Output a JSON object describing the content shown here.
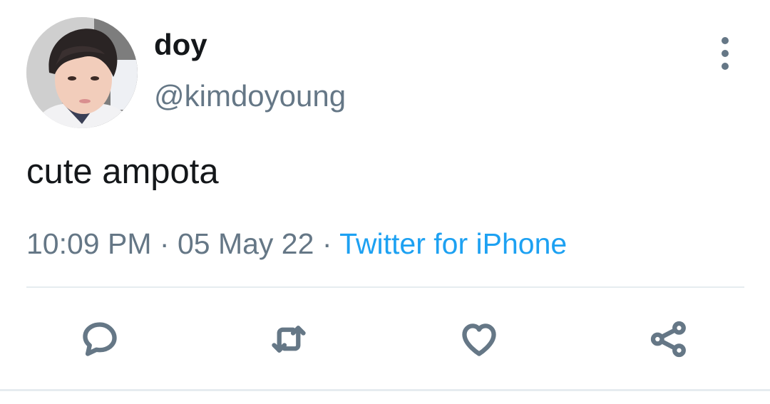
{
  "tweet": {
    "author": {
      "display_name": "doy",
      "handle": "@kimdoyoung",
      "avatar_icon": "profile-photo"
    },
    "text": "cute ampota",
    "time": "10:09 PM",
    "date": "05 May 22",
    "separator": "·",
    "source": "Twitter for iPhone"
  },
  "actions": {
    "reply_icon": "speech-bubble-icon",
    "retweet_icon": "retweet-arrows-icon",
    "like_icon": "heart-icon",
    "share_icon": "share-nodes-icon",
    "more_icon": "vertical-ellipsis-icon"
  },
  "colors": {
    "text_primary": "#14171a",
    "text_secondary": "#657786",
    "link": "#1da1f2",
    "divider": "#e6ecf0"
  }
}
